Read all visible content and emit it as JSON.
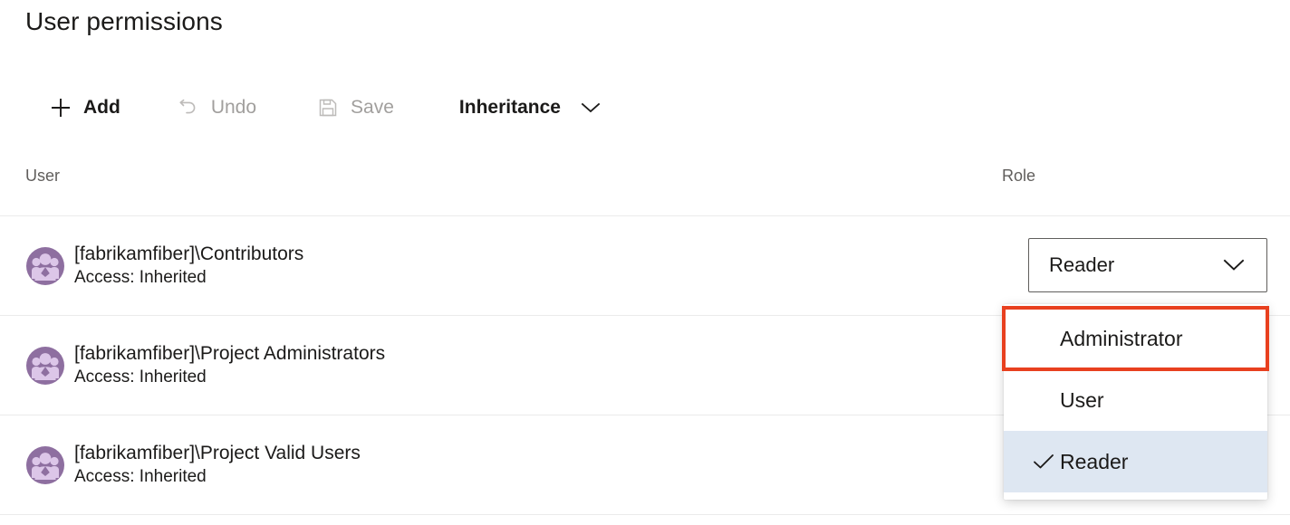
{
  "page": {
    "title": "User permissions"
  },
  "toolbar": {
    "items": [
      {
        "id": "add",
        "label": "Add",
        "icon": "plus-icon",
        "state": "enabled",
        "icon_name": "add-icon"
      },
      {
        "id": "undo",
        "label": "Undo",
        "icon": "undo-icon",
        "state": "disabled",
        "icon_name": "undo-icon"
      },
      {
        "id": "save",
        "label": "Save",
        "icon": "save-icon",
        "state": "disabled",
        "icon_name": "save-floppy-icon"
      },
      {
        "id": "inheritance",
        "label": "Inheritance",
        "icon": "chevron-down",
        "state": "enabled",
        "icon_name": "chevron-down-icon"
      }
    ]
  },
  "table": {
    "columns": {
      "user": "User",
      "role": "Role"
    },
    "rows": [
      {
        "name": "[fabrikamfiber]\\Contributors",
        "access": "Access: Inherited",
        "avatar": "group-avatar-icon",
        "role": "Reader"
      },
      {
        "name": "[fabrikamfiber]\\Project Administrators",
        "access": "Access: Inherited",
        "avatar": "group-avatar-icon",
        "role": ""
      },
      {
        "name": "[fabrikamfiber]\\Project Valid Users",
        "access": "Access: Inherited",
        "avatar": "group-avatar-icon",
        "role": ""
      }
    ]
  },
  "role_combobox": {
    "value": "Reader",
    "expanded": true,
    "chevron": "chevron-down-icon"
  },
  "role_dropdown": {
    "options": [
      {
        "label": "Administrator",
        "selected": false,
        "highlighted": true
      },
      {
        "label": "User",
        "selected": false,
        "highlighted": false
      },
      {
        "label": "Reader",
        "selected": true,
        "highlighted": false
      }
    ],
    "check_icon": "checkmark-icon"
  },
  "colors": {
    "highlight_red": "#e8401f",
    "selected_blue": "#dee7f2",
    "avatar_purple": "#8e6fa0",
    "avatar_light": "#dcc6e8",
    "disabled_gray": "#a19f9d",
    "row_divider": "#ebebeb"
  }
}
